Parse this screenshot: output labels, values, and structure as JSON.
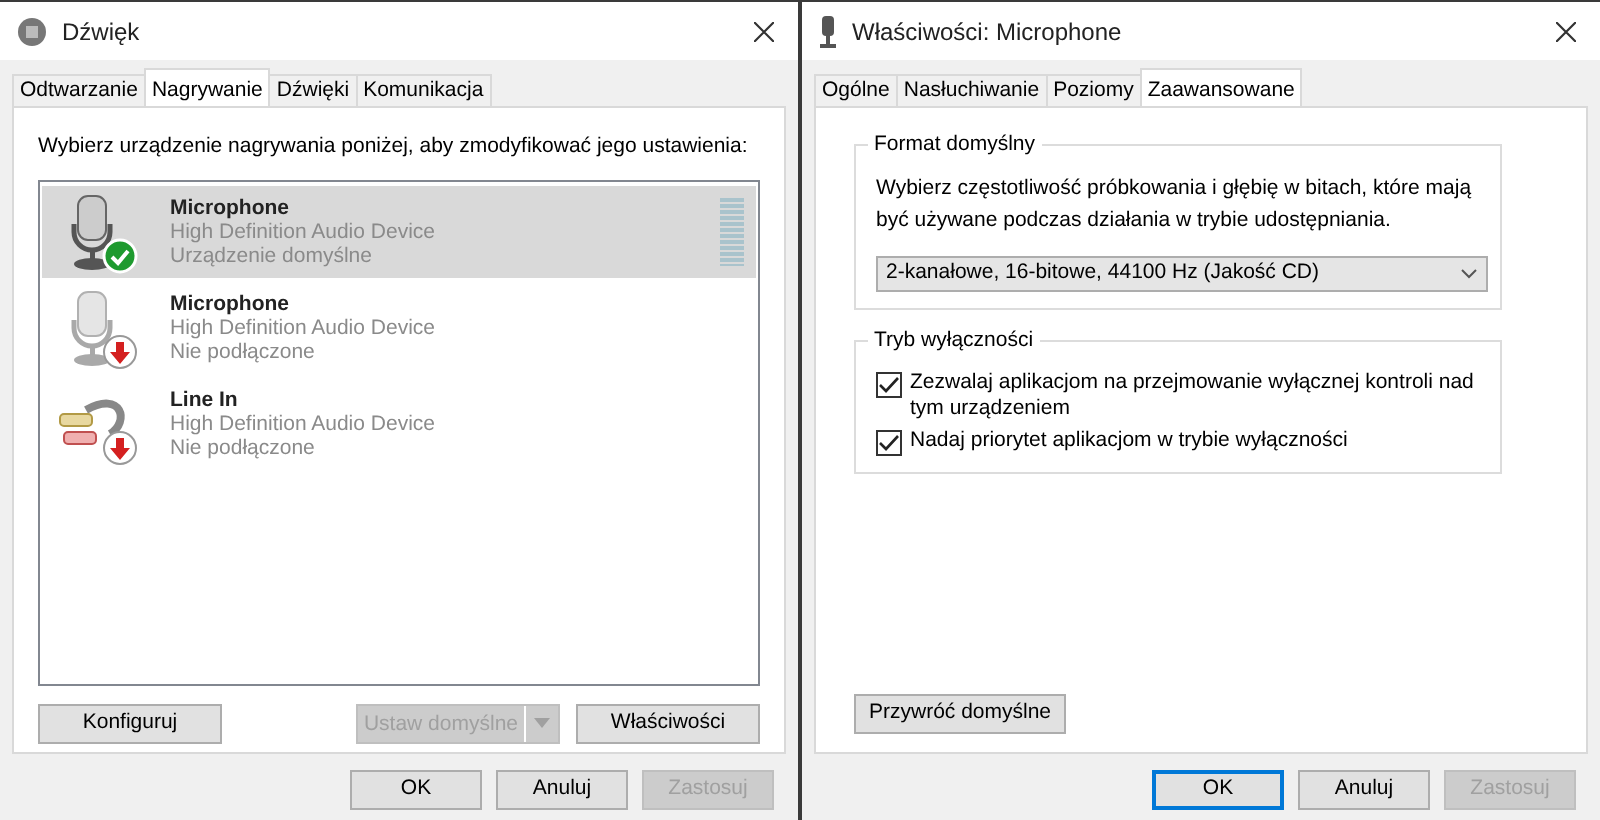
{
  "sound_window": {
    "title": "Dźwięk",
    "tabs": [
      {
        "label": "Odtwarzanie",
        "selected": false
      },
      {
        "label": "Nagrywanie",
        "selected": true
      },
      {
        "label": "Dźwięki",
        "selected": false
      },
      {
        "label": "Komunikacja",
        "selected": false
      }
    ],
    "instruction": "Wybierz urządzenie nagrywania poniżej, aby zmodyfikować jego ustawienia:",
    "devices": [
      {
        "kind": "microphone",
        "name": "Microphone",
        "driver": "High Definition Audio Device",
        "status": "Urządzenie domyślne",
        "is_default": true,
        "connected": true,
        "selected": true,
        "level": 0
      },
      {
        "kind": "microphone",
        "name": "Microphone",
        "driver": "High Definition Audio Device",
        "status": "Nie podłączone",
        "is_default": false,
        "connected": false,
        "selected": false
      },
      {
        "kind": "line_in",
        "name": "Line In",
        "driver": "High Definition Audio Device",
        "status": "Nie podłączone",
        "is_default": false,
        "connected": false,
        "selected": false
      }
    ],
    "buttons": [
      {
        "label": "Konfiguruj",
        "kind": "plain",
        "disabled": false
      },
      {
        "label": "Ustaw domyślne",
        "kind": "split",
        "disabled": true
      },
      {
        "label": "Właściwości",
        "kind": "plain",
        "disabled": false
      }
    ],
    "footer": [
      {
        "label": "OK",
        "disabled": false,
        "focused": false
      },
      {
        "label": "Anuluj",
        "disabled": false,
        "focused": false
      },
      {
        "label": "Zastosuj",
        "disabled": true,
        "focused": false
      }
    ]
  },
  "properties_window": {
    "title": "Właściwości: Microphone",
    "tabs": [
      {
        "label": "Ogólne",
        "selected": false
      },
      {
        "label": "Nasłuchiwanie",
        "selected": false
      },
      {
        "label": "Poziomy",
        "selected": false
      },
      {
        "label": "Zaawansowane",
        "selected": true
      }
    ],
    "format_group": {
      "title": "Format domyślny",
      "description": "Wybierz częstotliwość próbkowania i głębię w bitach, które mają być używane podczas działania w trybie udostępniania.",
      "value": "2-kanałowe, 16-bitowe, 44100 Hz (Jakość CD)"
    },
    "exclusive_group": {
      "title": "Tryb wyłączności",
      "options": [
        {
          "label": "Zezwalaj aplikacjom na przejmowanie wyłącznej kontroli nad tym urządzeniem",
          "checked": true
        },
        {
          "label": "Nadaj priorytet aplikacjom w trybie wyłączności",
          "checked": true
        }
      ]
    },
    "restore_button": "Przywróć domyślne",
    "footer": [
      {
        "label": "OK",
        "disabled": false,
        "focused": true
      },
      {
        "label": "Anuluj",
        "disabled": false,
        "focused": false
      },
      {
        "label": "Zastosuj",
        "disabled": true,
        "focused": false
      }
    ]
  }
}
